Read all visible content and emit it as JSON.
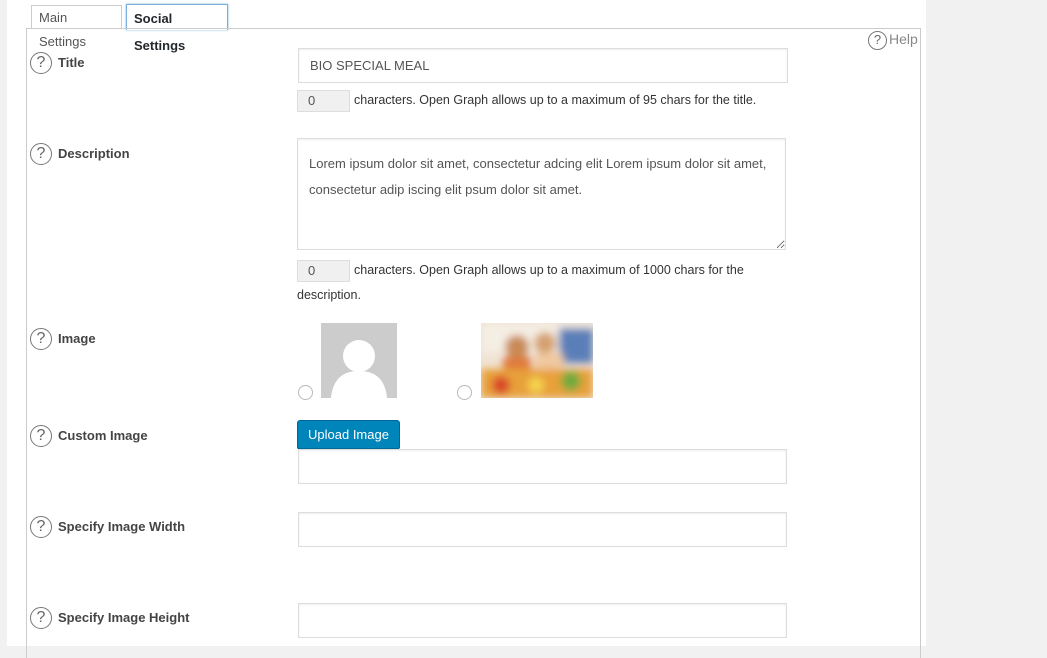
{
  "tabs": {
    "main": "Main Settings",
    "social": "Social Settings"
  },
  "help": {
    "label": "Help",
    "icon": "question-circle-icon"
  },
  "fields": {
    "title": {
      "label": "Title",
      "value": "BIO SPECIAL MEAL",
      "count": "0",
      "hint": "characters. Open Graph allows up to a maximum of 95 chars for the title."
    },
    "description": {
      "label": "Description",
      "value": "Lorem ipsum dolor sit amet, consectetur adcing elit Lorem ipsum dolor sit amet, consectetur adip iscing elit psum dolor sit amet.",
      "count": "0",
      "hint_line1": "characters. Open Graph allows up to a maximum of 1000 chars for the",
      "hint_line2": "description."
    },
    "image": {
      "label": "Image",
      "options": [
        {
          "name": "default-avatar",
          "selected": false
        },
        {
          "name": "featured-photo",
          "selected": false
        }
      ]
    },
    "custom_image": {
      "label": "Custom Image",
      "button": "Upload Image",
      "value": ""
    },
    "image_width": {
      "label": "Specify Image Width",
      "value": ""
    },
    "image_height": {
      "label": "Specify Image Height",
      "value": ""
    }
  },
  "colors": {
    "primary_button": "#0085ba",
    "active_tab_border": "#7aaed8"
  }
}
